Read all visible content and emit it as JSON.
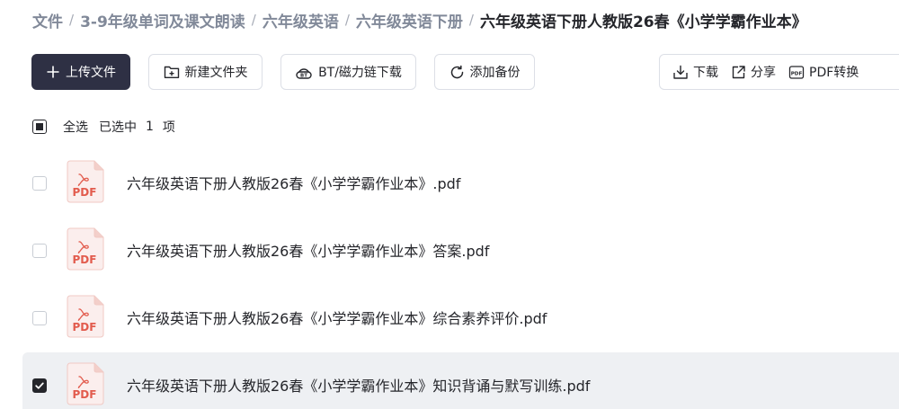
{
  "breadcrumb": {
    "items": [
      "文件",
      "3-9年级单词及课文朗读",
      "六年级英语",
      "六年级英语下册"
    ],
    "current": "六年级英语下册人教版26春《小学学霸作业本》",
    "separator": "/"
  },
  "toolbar": {
    "upload_label": "上传文件",
    "new_folder_label": "新建文件夹",
    "bt_label": "BT/磁力链下载",
    "backup_label": "添加备份",
    "download_label": "下载",
    "share_label": "分享",
    "pdf_convert_label": "PDF转换"
  },
  "selection": {
    "select_all_label": "全选",
    "selected_prefix": "已选中",
    "selected_count": "1",
    "selected_unit": "项"
  },
  "files": [
    {
      "name": "六年级英语下册人教版26春《小学学霸作业本》.pdf",
      "selected": false
    },
    {
      "name": "六年级英语下册人教版26春《小学学霸作业本》答案.pdf",
      "selected": false
    },
    {
      "name": "六年级英语下册人教版26春《小学学霸作业本》综合素养评价.pdf",
      "selected": false
    },
    {
      "name": "六年级英语下册人教版26春《小学学霸作业本》知识背诵与默写训练.pdf",
      "selected": true
    }
  ],
  "file_icon_text": "PDF",
  "colors": {
    "primary": "#2e3044",
    "pdf_red": "#e25b4d",
    "selected_row": "#eef0f3"
  }
}
